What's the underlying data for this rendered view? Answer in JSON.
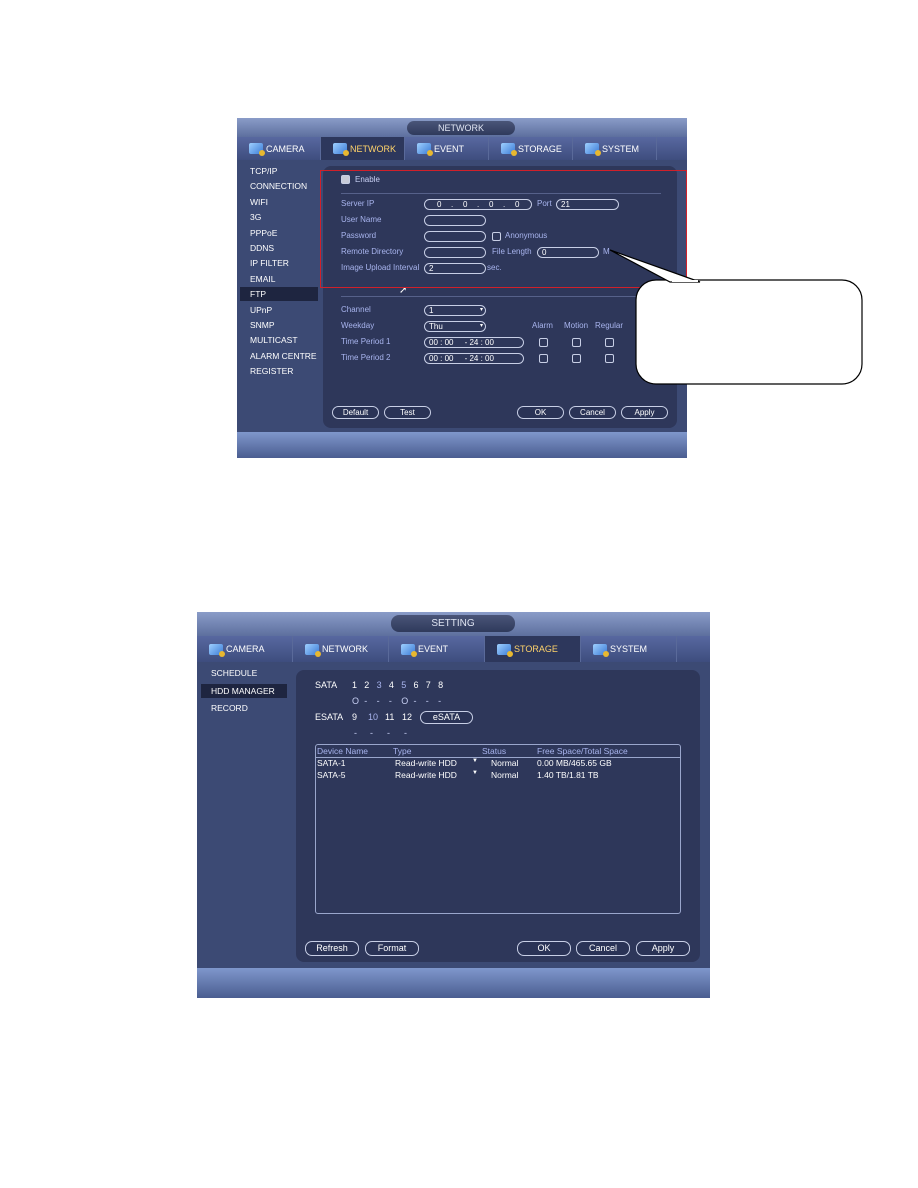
{
  "ftp_screen": {
    "title": "NETWORK",
    "tabs": [
      {
        "label": "CAMERA",
        "icon": "camera-icon"
      },
      {
        "label": "NETWORK",
        "icon": "network-icon",
        "active": true
      },
      {
        "label": "EVENT",
        "icon": "event-icon"
      },
      {
        "label": "STORAGE",
        "icon": "storage-icon"
      },
      {
        "label": "SYSTEM",
        "icon": "system-icon"
      }
    ],
    "sidebar": [
      "TCP/IP",
      "CONNECTION",
      "WIFI",
      "3G",
      "PPPoE",
      "DDNS",
      "IP FILTER",
      "EMAIL",
      "FTP",
      "UPnP",
      "SNMP",
      "MULTICAST",
      "ALARM CENTRE",
      "REGISTER"
    ],
    "sidebar_active": "FTP",
    "enable_label": "Enable",
    "enable_checked": false,
    "server_ip_label": "Server IP",
    "server_ip": [
      "0",
      "0",
      "0",
      "0"
    ],
    "port_label": "Port",
    "port": "21",
    "user_name_label": "User Name",
    "user_name": "",
    "password_label": "Password",
    "password": "",
    "anonymous_label": "Anonymous",
    "remote_dir_label": "Remote Directory",
    "remote_dir": "",
    "file_length_label": "File Length",
    "file_length": "0",
    "file_length_unit": "M",
    "interval_label": "Image Upload Interval",
    "interval": "2",
    "interval_unit": "sec.",
    "channel_label": "Channel",
    "channel": "1",
    "weekday_label": "Weekday",
    "weekday": "Thu",
    "col_alarm": "Alarm",
    "col_motion": "Motion",
    "col_regular": "Regular",
    "periods": [
      {
        "label": "Time Period 1",
        "value": "00 : 00     - 24 : 00"
      },
      {
        "label": "Time Period 2",
        "value": "00 : 00     - 24 : 00"
      }
    ],
    "buttons": {
      "default": "Default",
      "test": "Test",
      "ok": "OK",
      "cancel": "Cancel",
      "apply": "Apply"
    },
    "highlight_color": "#d0202a"
  },
  "hdd_screen": {
    "title": "SETTING",
    "tabs": [
      {
        "label": "CAMERA",
        "icon": "camera-icon"
      },
      {
        "label": "NETWORK",
        "icon": "network-icon"
      },
      {
        "label": "EVENT",
        "icon": "event-icon"
      },
      {
        "label": "STORAGE",
        "icon": "storage-icon",
        "active": true
      },
      {
        "label": "SYSTEM",
        "icon": "system-icon"
      }
    ],
    "sidebar": [
      "SCHEDULE",
      "HDD MANAGER",
      "RECORD"
    ],
    "sidebar_active": "HDD MANAGER",
    "sata_label": "SATA",
    "sata_ports": [
      "1",
      "2",
      "3",
      "4",
      "5",
      "6",
      "7",
      "8"
    ],
    "sata_status": [
      "O",
      "-",
      "-",
      "-",
      "O",
      "-",
      "-",
      "-"
    ],
    "esata_label": "ESATA",
    "esata_ports": [
      "9",
      "10",
      "11",
      "12"
    ],
    "esata_status": [
      "-",
      "-",
      "-",
      "-"
    ],
    "esata_button": "eSATA",
    "table_headers": [
      "Device Name",
      "Type",
      "Status",
      "Free Space/Total Space"
    ],
    "rows": [
      [
        "SATA-1",
        "Read-write HDD",
        "Normal",
        "0.00 MB/465.65 GB"
      ],
      [
        "SATA-5",
        "Read-write HDD",
        "Normal",
        "1.40 TB/1.81 TB"
      ]
    ],
    "buttons": {
      "refresh": "Refresh",
      "format": "Format",
      "ok": "OK",
      "cancel": "Cancel",
      "apply": "Apply"
    }
  }
}
